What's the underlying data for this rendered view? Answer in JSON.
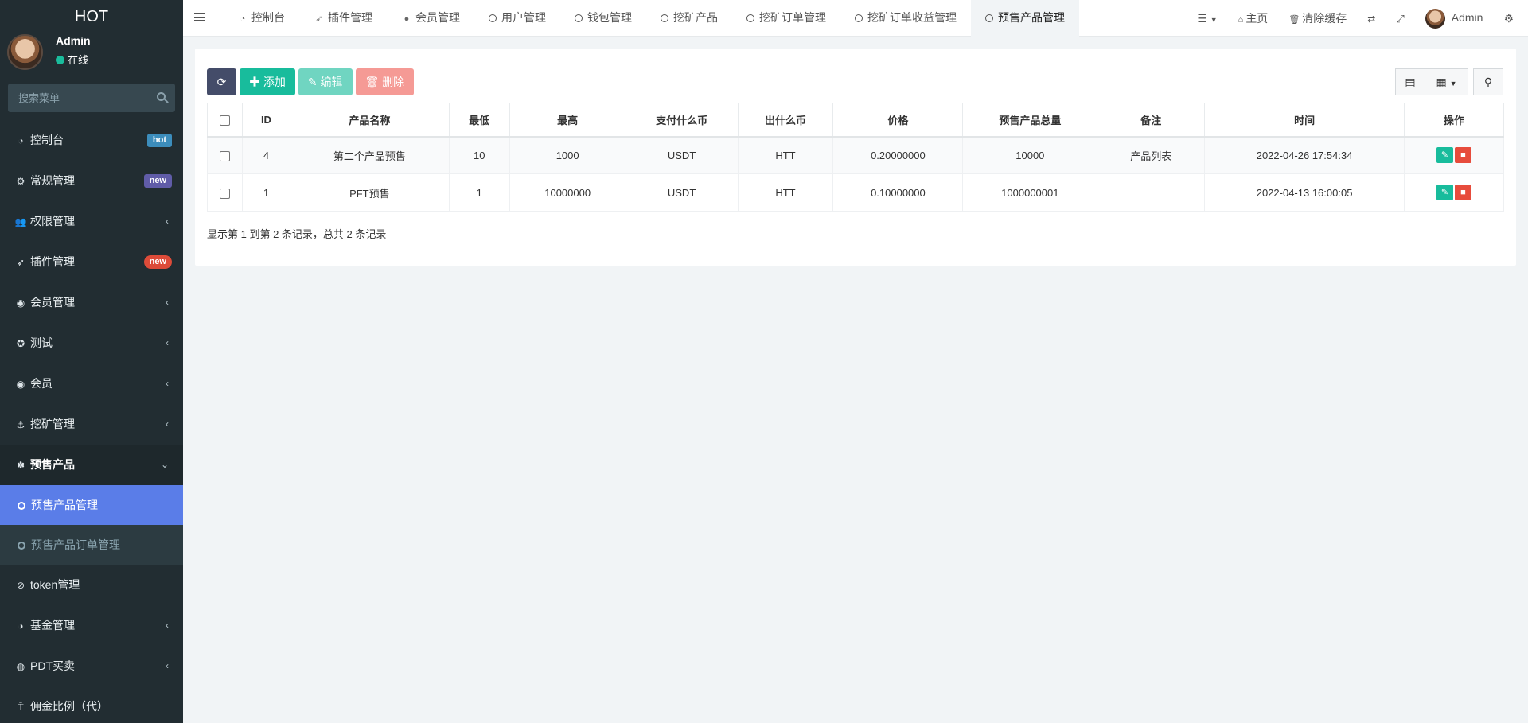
{
  "app": {
    "logo": "HOT"
  },
  "user": {
    "name": "Admin",
    "status": "在线"
  },
  "sidebar": {
    "search_placeholder": "搜索菜单",
    "items": [
      {
        "label": "控制台",
        "icon": "dashboard-icon",
        "badge": "hot",
        "badge_color": "#3c8dbc"
      },
      {
        "label": "常规管理",
        "icon": "cogs-icon",
        "badge": "new",
        "badge_color": "#605ca8"
      },
      {
        "label": "权限管理",
        "icon": "group-icon"
      },
      {
        "label": "插件管理",
        "icon": "rocket-icon",
        "badge": "new",
        "badge_color": "#dd4b39"
      },
      {
        "label": "会员管理",
        "icon": "user-circle-icon"
      },
      {
        "label": "测试",
        "icon": "medal-icon"
      },
      {
        "label": "会员",
        "icon": "user-circle-icon"
      },
      {
        "label": "挖矿管理",
        "icon": "anchor-icon"
      },
      {
        "label": "预售产品",
        "icon": "yelp-icon"
      }
    ],
    "sub_items": [
      {
        "label": "预售产品管理"
      },
      {
        "label": "预售产品订单管理"
      }
    ],
    "items_after": [
      {
        "label": "token管理",
        "icon": "refresh-circle-icon"
      },
      {
        "label": "基金管理",
        "icon": "adjust-icon"
      },
      {
        "label": "PDT买卖",
        "icon": "compass-icon"
      },
      {
        "label": "佣金比例（代）",
        "icon": "pin-icon"
      }
    ]
  },
  "tabs": [
    {
      "label": "控制台",
      "icon": "dashboard-icon"
    },
    {
      "label": "插件管理",
      "icon": "rocket-icon"
    },
    {
      "label": "会员管理",
      "icon": "user-icon"
    },
    {
      "label": "用户管理",
      "icon": "circle-icon"
    },
    {
      "label": "钱包管理",
      "icon": "circle-icon"
    },
    {
      "label": "挖矿产品",
      "icon": "circle-icon"
    },
    {
      "label": "挖矿订单管理",
      "icon": "circle-icon"
    },
    {
      "label": "挖矿订单收益管理",
      "icon": "circle-icon"
    },
    {
      "label": "预售产品管理",
      "icon": "circle-icon"
    }
  ],
  "topright": {
    "home": "主页",
    "clear_cache": "清除缓存",
    "admin": "Admin"
  },
  "toolbar": {
    "add": "添加",
    "edit": "编辑",
    "delete": "删除"
  },
  "table": {
    "columns": [
      "ID",
      "产品名称",
      "最低",
      "最高",
      "支付什么币",
      "出什么币",
      "价格",
      "预售产品总量",
      "备注",
      "时间",
      "操作"
    ],
    "rows": [
      {
        "id": "4",
        "name": "第二个产品预售",
        "min": "10",
        "max": "1000",
        "pay": "USDT",
        "out": "HTT",
        "price": "0.20000000",
        "total": "10000",
        "remark": "产品列表",
        "time": "2022-04-26 17:54:34"
      },
      {
        "id": "1",
        "name": "PFT预售",
        "min": "1",
        "max": "10000000",
        "pay": "USDT",
        "out": "HTT",
        "price": "0.10000000",
        "total": "1000000001",
        "remark": "",
        "time": "2022-04-13 16:00:05"
      }
    ]
  },
  "summary": "显示第 1 到第 2 条记录，总共 2 条记录"
}
